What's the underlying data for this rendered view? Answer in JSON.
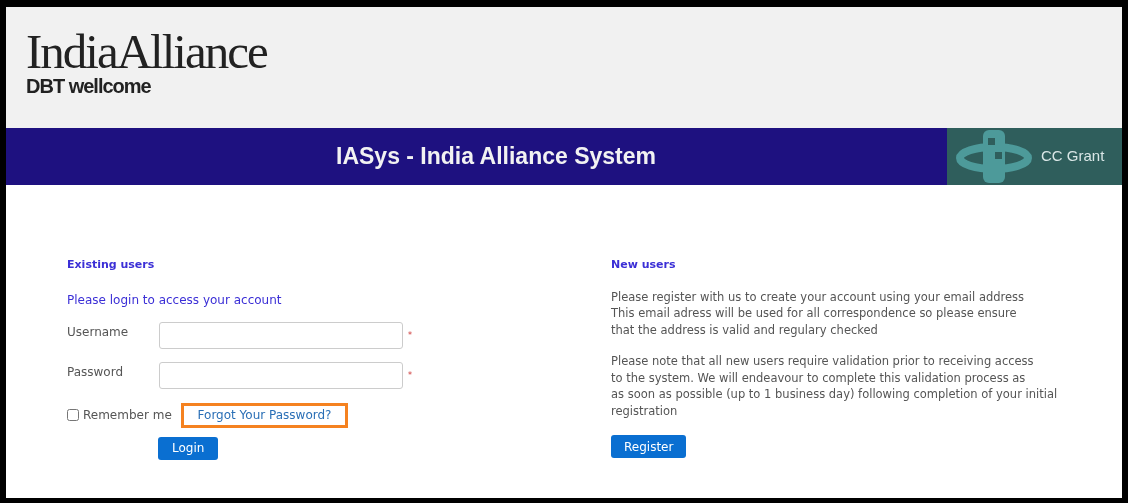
{
  "header": {
    "logo_title": "IndiaAlliance",
    "logo_subtitle": "DBT wellcome"
  },
  "banner": {
    "title": "IASys - India Alliance System",
    "side_label": "CC Grant"
  },
  "existing_users": {
    "heading": "Existing users",
    "intro": "Please login to access your account",
    "fields": [
      {
        "label": "Username",
        "required_mark": "*"
      },
      {
        "label": "Password",
        "required_mark": "*"
      }
    ],
    "remember": {
      "label": "Remember me",
      "checked": false
    },
    "forgot_link": {
      "label": "Forgot Your Password?",
      "highlighted": true
    },
    "login_button": "Login"
  },
  "new_users": {
    "heading": "New users",
    "paragraphs": [
      [
        "Please register with us to create your account using your email address",
        "This email adress will be used for all correspondence so please ensure",
        "that the address is valid and regulary checked"
      ],
      [
        "Please note that all new users require validation prior to receiving access",
        "to the system. We will endeavour to complete this validation process as",
        "as soon as possible (up to 1 business day) following completion of your initial",
        "registration"
      ]
    ],
    "register_button": "Register"
  }
}
